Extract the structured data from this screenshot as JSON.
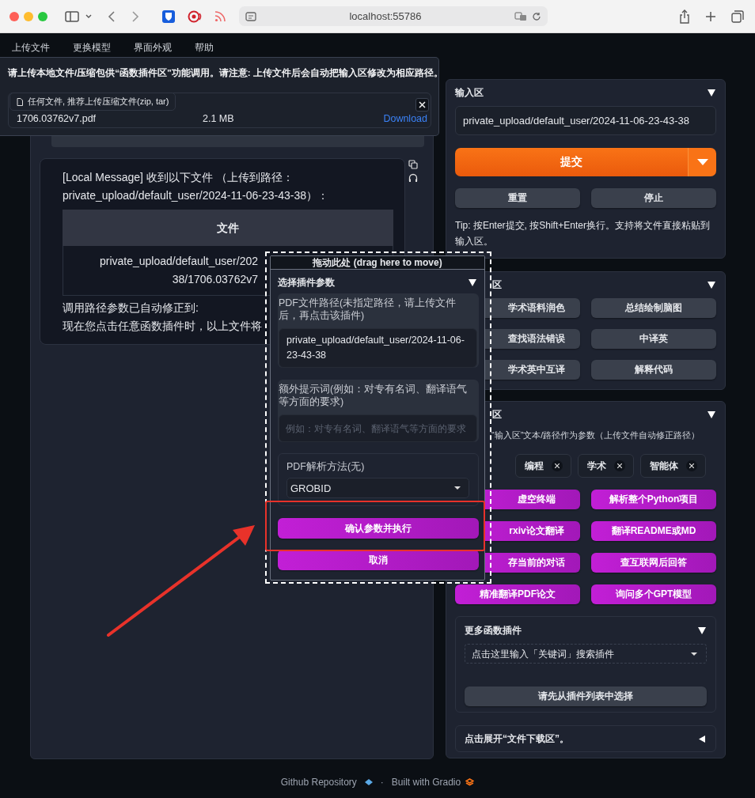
{
  "browser": {
    "address": "localhost:55786"
  },
  "menu": [
    "上传文件",
    "更换模型",
    "界面外观",
    "帮助"
  ],
  "upload_panel": {
    "notice": "请上传本地文件/压缩包供“函数插件区”功能调用。请注意: 上传文件后会自动把输入区修改为相应路径。",
    "drop_label": "任何文件, 推荐上传压缩文件(zip, tar)",
    "file": {
      "name": "1706.03762v7.pdf",
      "size": "2.1 MB",
      "action": "Download"
    }
  },
  "chat": {
    "lines": [
      "[Local Message] 收到以下文件 （上传到路径：",
      "private_upload/default_user/2024-11-06-23-43-38）："
    ],
    "table": {
      "column": "文件",
      "cell_lines": [
        "private_upload/default_user/202",
        "38/1706.03762v7"
      ]
    },
    "after": [
      "调用路径参数已自动修正到:",
      "现在您点击任意函数插件时，以上文件将"
    ]
  },
  "input_area": {
    "title": "输入区",
    "expanded": true,
    "value": "private_upload/default_user/2024-11-06-23-43-38",
    "submit": "提交",
    "buttons": [
      "重置",
      "停止"
    ],
    "tip": "Tip: 按Enter提交, 按Shift+Enter换行。支持将文件直接粘贴到输入区。"
  },
  "basic_area": {
    "title": "区",
    "expanded": true,
    "buttons": [
      "学术语料润色",
      "总结绘制脑图",
      "查找语法错误",
      "中译英",
      "学术英中互译",
      "解释代码"
    ]
  },
  "plugin_area": {
    "title": "区",
    "expanded": true,
    "hint": "“输入区”文本/路径作为参数（上传文件自动修正路径）",
    "tags": [
      "编程",
      "学术",
      "智能体"
    ],
    "buttons": [
      "虚空终端",
      "解析整个Python项目",
      "rxiv论文翻译",
      "翻译README或MD",
      "存当前的对话",
      "查互联网后回答",
      "精准翻译PDF论文",
      "询问多个GPT模型"
    ],
    "more": {
      "title": "更多函数插件",
      "expanded": true,
      "placeholder": "点击这里输入「关键词」搜索插件",
      "button": "请先从插件列表中选择"
    }
  },
  "download_area": {
    "title": "点击展开“文件下载区”。",
    "expanded": false
  },
  "popup": {
    "drag_label": "拖动此处 (drag here to move)",
    "title": "选择插件参数",
    "expanded": true,
    "fields": [
      {
        "kind": "textarea",
        "label": "PDF文件路径(未指定路径，请上传文件后，再点击该插件)",
        "value": "private_upload/default_user/2024-11-06-23-43-38"
      },
      {
        "kind": "input",
        "label": "额外提示词(例如：对专有名词、翻译语气等方面的要求)",
        "placeholder": "例如：对专有名词、翻译语气等方面的要求"
      },
      {
        "kind": "dropdown",
        "label": "PDF解析方法(无)",
        "value": "GROBID"
      }
    ],
    "confirm": "确认参数并执行",
    "cancel": "取消"
  },
  "footer": {
    "links": [
      "Github Repository",
      "Built with Gradio"
    ],
    "separator": "·"
  }
}
